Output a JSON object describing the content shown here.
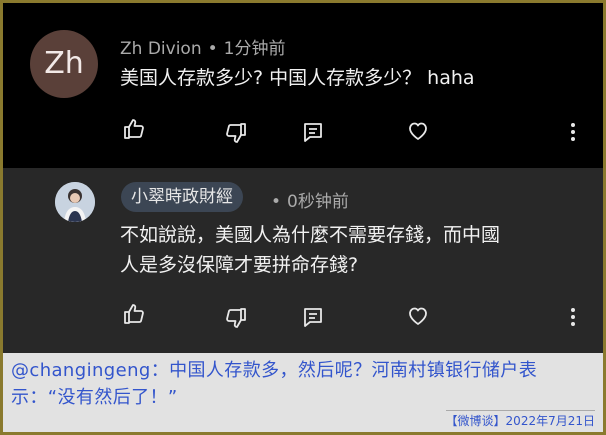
{
  "comments": [
    {
      "avatar_initials": "Zh",
      "author": "Zh Divion",
      "time": "1分钟前",
      "text": "美国人存款多少? 中国人存款多少？ haha",
      "actions": [
        "thumb-up-icon",
        "thumb-down-icon",
        "comment-icon",
        "heart-icon",
        "more-vert-icon"
      ]
    },
    {
      "author": "小翠時政財經",
      "time": "0秒钟前",
      "text_line1": "不如說說，美國人為什麼不需要存錢，而中國",
      "text_line2": "人是多沒保障才要拼命存錢?",
      "actions": [
        "thumb-up-icon",
        "thumb-down-icon",
        "comment-icon",
        "heart-icon",
        "more-vert-icon"
      ]
    }
  ],
  "separator": "•",
  "caption": {
    "line1": "@changingeng：中国人存款多，然后呢？河南村镇银行储户表",
    "line2": "示：“没有然后了！”",
    "credit": "【微博谈】2022年7月21日"
  },
  "colors": {
    "border": "#8a7a2e",
    "caption_text": "#3355cc",
    "top_bg": "#000000",
    "reply_bg": "#282828"
  }
}
